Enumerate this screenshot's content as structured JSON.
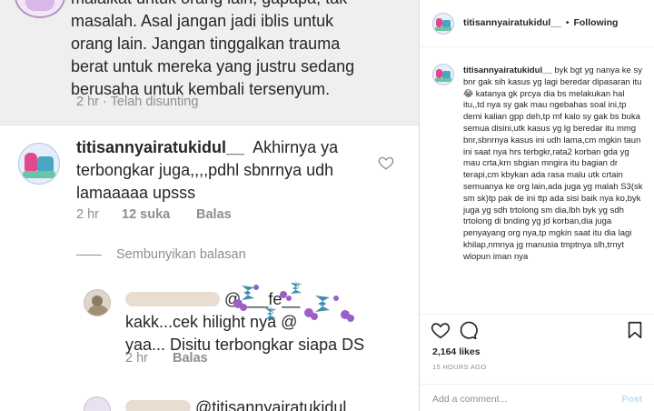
{
  "post": {
    "lines": [
      "malaikat untuk orang lain, gapapa, tak",
      "masalah. Asal jangan jadi iblis untuk",
      "orang lain. Jangan tinggalkan trauma",
      "berat untuk mereka yang justru sedang",
      "berusaha untuk kembali tersenyum."
    ],
    "time": "2 hr",
    "edited": "Telah disunting",
    "sep": "·"
  },
  "comment1": {
    "username": "titisannyairatukidul__",
    "text": "Akhirnya ya terbongkar juga,,,,pdhl sbnrnya udh lamaaaaa upsss",
    "time": "2 hr",
    "likes": "12 suka",
    "reply": "Balas"
  },
  "hide_replies": "Sembunyikan balasan",
  "comment2": {
    "mention": "@___fe__",
    "line2": "kakk...cek hilight nya @",
    "line3": "yaa... Disitu terbongkar siapa DS",
    "time": "2 hr",
    "reply": "Balas"
  },
  "comment3": {
    "mention": "@titisannyairatukidul__"
  },
  "sidebar": {
    "username": "titisannyairatukidul__",
    "sep": "•",
    "follow": "Following",
    "caption_user": "titisannyairatukidul__",
    "caption": "byk bgt yg nanya ke sy bnr gak sih kasus yg lagi beredar dipasaran itu😂 katanya gk prcya dia bs melakukan hal itu,,td nya sy gak mau ngebahas soal ini,tp demi kalian gpp deh,tp mf kalo sy gak bs buka semua disini,utk kasus yg lg beredar itu mmg bnr,sbnrnya kasus ini udh lama,cm mgkin taun ini saat nya hrs terbgkr,rata2 korban gda yg mau crta,krn sbgian mngira itu bagian dr terapi,cm kbykan ada rasa malu utk crtain semuanya ke org lain,ada juga yg malah S3(sk sm sk)tp pak de ini ttp ada sisi baik nya ko,byk juga yg sdh trtolong sm dia,lbh byk yg sdh trtolong di bnding yg jd korban,dia juga penyayang org nya,tp mgkin saat itu dia lagi khilap,nmnya jg manusia tmptnya slh,trnyt wlopun iman nya",
    "likes": "2,164 likes",
    "time": "15 HOURS AGO",
    "add_comment_placeholder": "Add a comment...",
    "post_label": "Post",
    "colors": {
      "link_disabled": "#b2dffc",
      "muted": "#8e8e8e",
      "text": "#262626"
    }
  },
  "icons": [
    "heart-icon",
    "comment-icon",
    "bookmark-icon",
    "flower-sticker-icon"
  ]
}
